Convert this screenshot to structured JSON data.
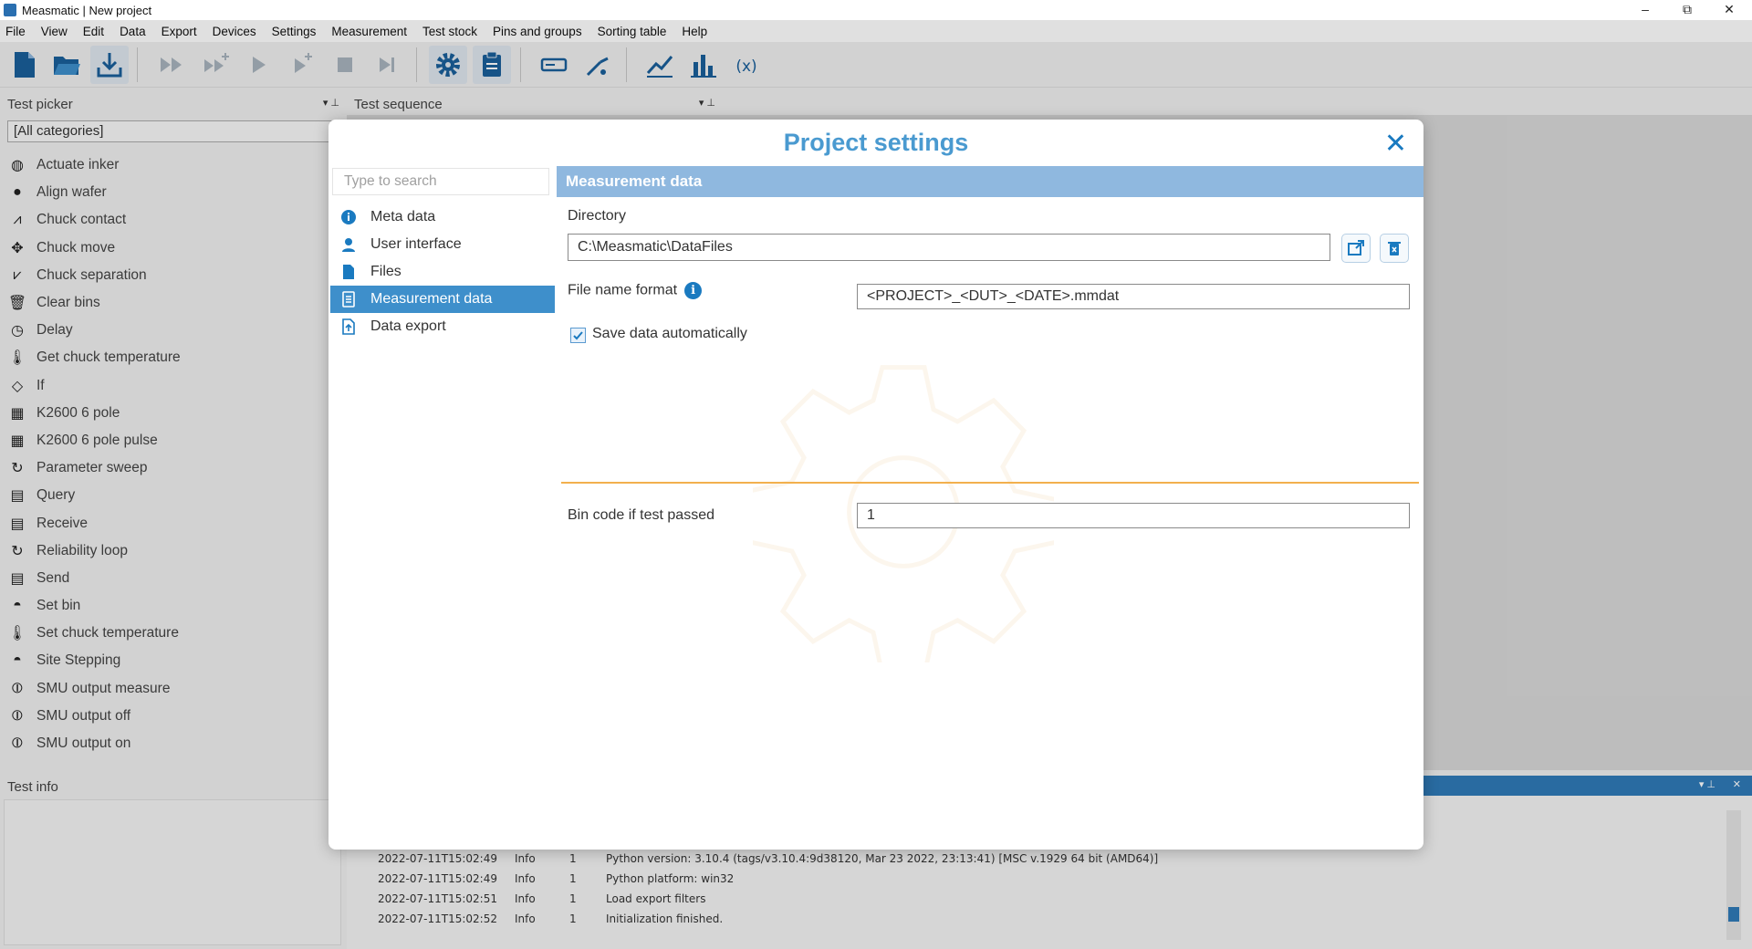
{
  "window": {
    "title": "Measmatic | New project",
    "controls": {
      "minimize": "–",
      "maximize": "⧉",
      "close": "✕"
    }
  },
  "menu": [
    "File",
    "View",
    "Edit",
    "Data",
    "Export",
    "Devices",
    "Settings",
    "Measurement",
    "Test stock",
    "Pins and groups",
    "Sorting table",
    "Help"
  ],
  "toolbar": {
    "icons": [
      "new-file-icon",
      "open-folder-icon",
      "save-download-icon",
      "run-all-icon",
      "run-step-add-icon",
      "play-icon",
      "step-play-icon",
      "stop-icon",
      "skip-end-icon",
      "gear-icon",
      "clipboard-icon",
      "device-icon",
      "probe-icon",
      "line-chart-icon",
      "bar-chart-icon",
      "variable-icon"
    ]
  },
  "test_picker": {
    "header": "Test picker",
    "category_select": "[All categories]",
    "items": [
      {
        "label": "Actuate inker",
        "icon": "inker-icon"
      },
      {
        "label": "Align wafer",
        "icon": "wafer-icon"
      },
      {
        "label": "Chuck contact",
        "icon": "chuck-contact-icon"
      },
      {
        "label": "Chuck move",
        "icon": "move-arrows-icon"
      },
      {
        "label": "Chuck separation",
        "icon": "chuck-separation-icon"
      },
      {
        "label": "Clear bins",
        "icon": "trash-icon"
      },
      {
        "label": "Delay",
        "icon": "stopwatch-icon"
      },
      {
        "label": "Get chuck temperature",
        "icon": "thermometer-icon"
      },
      {
        "label": "If",
        "icon": "decision-icon"
      },
      {
        "label": "K2600 6 pole",
        "icon": "instrument-icon"
      },
      {
        "label": "K2600 6 pole pulse",
        "icon": "instrument-pulse-icon"
      },
      {
        "label": "Parameter sweep",
        "icon": "loop-icon"
      },
      {
        "label": "Query",
        "icon": "terminal-icon"
      },
      {
        "label": "Receive",
        "icon": "terminal-receive-icon"
      },
      {
        "label": "Reliability loop",
        "icon": "loop-icon"
      },
      {
        "label": "Send",
        "icon": "terminal-send-icon"
      },
      {
        "label": "Set bin",
        "icon": "bin-icon"
      },
      {
        "label": "Set chuck temperature",
        "icon": "thermometer-icon"
      },
      {
        "label": "Site Stepping",
        "icon": "stepping-icon"
      },
      {
        "label": "SMU output measure",
        "icon": "smu-icon"
      },
      {
        "label": "SMU output off",
        "icon": "smu-icon"
      },
      {
        "label": "SMU output on",
        "icon": "smu-icon"
      }
    ]
  },
  "test_sequence": {
    "header": "Test sequence"
  },
  "test_info": {
    "header": "Test info"
  },
  "log": {
    "rows": [
      {
        "time": "2022-07-11T15:02:49",
        "level": "Info",
        "id": "1",
        "message": "Python version: 3.10.4 (tags/v3.10.4:9d38120, Mar 23 2022, 23:13:41) [MSC v.1929 64 bit (AMD64)]"
      },
      {
        "time": "2022-07-11T15:02:49",
        "level": "Info",
        "id": "1",
        "message": "Python platform: win32"
      },
      {
        "time": "2022-07-11T15:02:51",
        "level": "Info",
        "id": "1",
        "message": "Load export filters"
      },
      {
        "time": "2022-07-11T15:02:52",
        "level": "Info",
        "id": "1",
        "message": "Initialization finished."
      }
    ]
  },
  "dialog": {
    "title": "Project settings",
    "search_placeholder": "Type to search",
    "nav": [
      {
        "label": "Meta data",
        "icon": "info-icon",
        "selected": false
      },
      {
        "label": "User interface",
        "icon": "user-icon",
        "selected": false
      },
      {
        "label": "Files",
        "icon": "file-icon",
        "selected": false
      },
      {
        "label": "Measurement data",
        "icon": "document-list-icon",
        "selected": true
      },
      {
        "label": "Data export",
        "icon": "export-icon",
        "selected": false
      }
    ],
    "section_title": "Measurement data",
    "directory_label": "Directory",
    "directory_value": "C:\\Measmatic\\DataFiles",
    "filename_label": "File name format",
    "filename_value": "<PROJECT>_<DUT>_<DATE>.mmdat",
    "save_auto_label": "Save data automatically",
    "save_auto_checked": true,
    "bin_code_label": "Bin code if test passed",
    "bin_code_value": "1"
  },
  "colors": {
    "accent": "#1a7ac0",
    "title": "#4a9ad0",
    "section_bar": "#8fb8df",
    "selected_nav": "#3e8fcb",
    "divider": "#f2b04d"
  }
}
